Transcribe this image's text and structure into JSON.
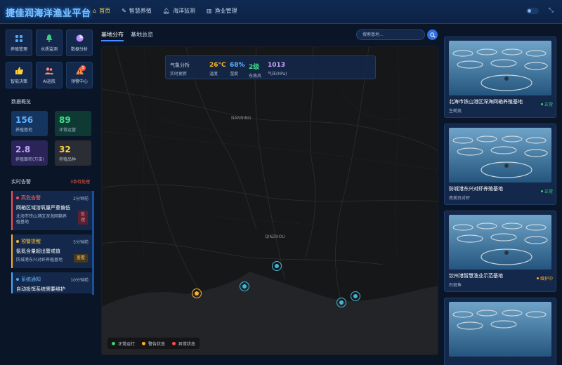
{
  "app": {
    "title": "捷佳润海洋渔业平台"
  },
  "nav": [
    {
      "label": "首页",
      "icon": "home-icon",
      "active": true
    },
    {
      "label": "智慧养殖",
      "icon": "pen-icon",
      "active": false
    },
    {
      "label": "海洋监测",
      "icon": "bell-icon",
      "active": false
    },
    {
      "label": "渔业管理",
      "icon": "bars-icon",
      "active": false
    }
  ],
  "quick_actions": [
    {
      "label": "养殖管理",
      "icon": "grid-icon",
      "color": "#4aa8ff"
    },
    {
      "label": "水质监测",
      "icon": "bell-icon",
      "color": "#34d07c"
    },
    {
      "label": "数据分析",
      "icon": "pie-icon",
      "color": "#b98cff"
    },
    {
      "label": "智能决策",
      "icon": "thumbs-up-icon",
      "color": "#ffce3a"
    },
    {
      "label": "AI巡航",
      "icon": "users-icon",
      "color": "#ff8a7a"
    },
    {
      "label": "预警中心",
      "icon": "warning-icon",
      "color": "#ff8a3c",
      "badge": "3"
    }
  ],
  "overview": {
    "title": "数据概览",
    "stats": [
      {
        "value": "156",
        "label": "养殖基地",
        "color": "#5fb2ff",
        "bg": "#153561"
      },
      {
        "value": "89",
        "label": "正常运营",
        "color": "#3fe08a",
        "bg": "#0f3a33"
      },
      {
        "value": "2.8",
        "label": "养殖面积(万亩)",
        "color": "#c9a2ff",
        "bg": "#2a2458"
      },
      {
        "value": "32",
        "label": "养殖品种",
        "color": "#ffd24a",
        "bg": "#2b2d34"
      }
    ]
  },
  "alerts": {
    "title": "实时告警",
    "count": "3条待处理",
    "items": [
      {
        "level": "高危告警",
        "time": "2分钟前",
        "message": "网箱区域溶氧量严重偏低",
        "detail": "北海市铁山港区深海网箱养殖基地",
        "action": "处理",
        "color": "#ff4d4f",
        "action_bg": "#5a2033",
        "action_color": "#ff8a8a"
      },
      {
        "level": "预警提醒",
        "time": "5分钟前",
        "message": "氨氮含量超出警戒值",
        "detail": "防城港东兴对虾养殖基地",
        "action": "查看",
        "color": "#ffb020",
        "action_bg": "#4a3a1c",
        "action_color": "#ffcf6a"
      },
      {
        "level": "系统通知",
        "time": "10分钟前",
        "message": "自动投饵系统需要维护",
        "detail": "",
        "action": "",
        "color": "#4aa8ff",
        "action_bg": "",
        "action_color": ""
      }
    ]
  },
  "map": {
    "tabs": [
      {
        "label": "基地分布",
        "active": true
      },
      {
        "label": "基地总览",
        "active": false
      }
    ],
    "search_placeholder": "搜索基地...",
    "weather": {
      "title": "气象分析",
      "subtitle": "实时更新",
      "items": [
        {
          "value": "26°C",
          "label": "温度",
          "color": "#ffb020"
        },
        {
          "value": "68%",
          "label": "湿度",
          "color": "#5fb2ff"
        },
        {
          "value": "2级",
          "label": "东南风",
          "color": "#3fe08a"
        },
        {
          "value": "1013",
          "label": "气压(hPa)",
          "color": "#c9a2ff"
        }
      ]
    },
    "places": [
      "NANNING",
      "QINZHOU"
    ],
    "legend": [
      {
        "label": "正常运行",
        "color": "#3fd07a"
      },
      {
        "label": "警告状态",
        "color": "#ffb020"
      },
      {
        "label": "异常状态",
        "color": "#ff4d4f"
      }
    ]
  },
  "bases": [
    {
      "name": "北海市铁山港区深海网箱养殖基地",
      "species": "生蚝类",
      "status": "正常",
      "status_color": "#3fd07a"
    },
    {
      "name": "防城港东兴对虾养殖基地",
      "species": "南美白对虾",
      "status": "正常",
      "status_color": "#3fd07a"
    },
    {
      "name": "钦州港智慧渔业示范基地",
      "species": "石斑鱼",
      "status": "维护中",
      "status_color": "#ffb020"
    },
    {
      "name": "",
      "species": "",
      "status": "",
      "status_color": "#3fd07a"
    }
  ]
}
